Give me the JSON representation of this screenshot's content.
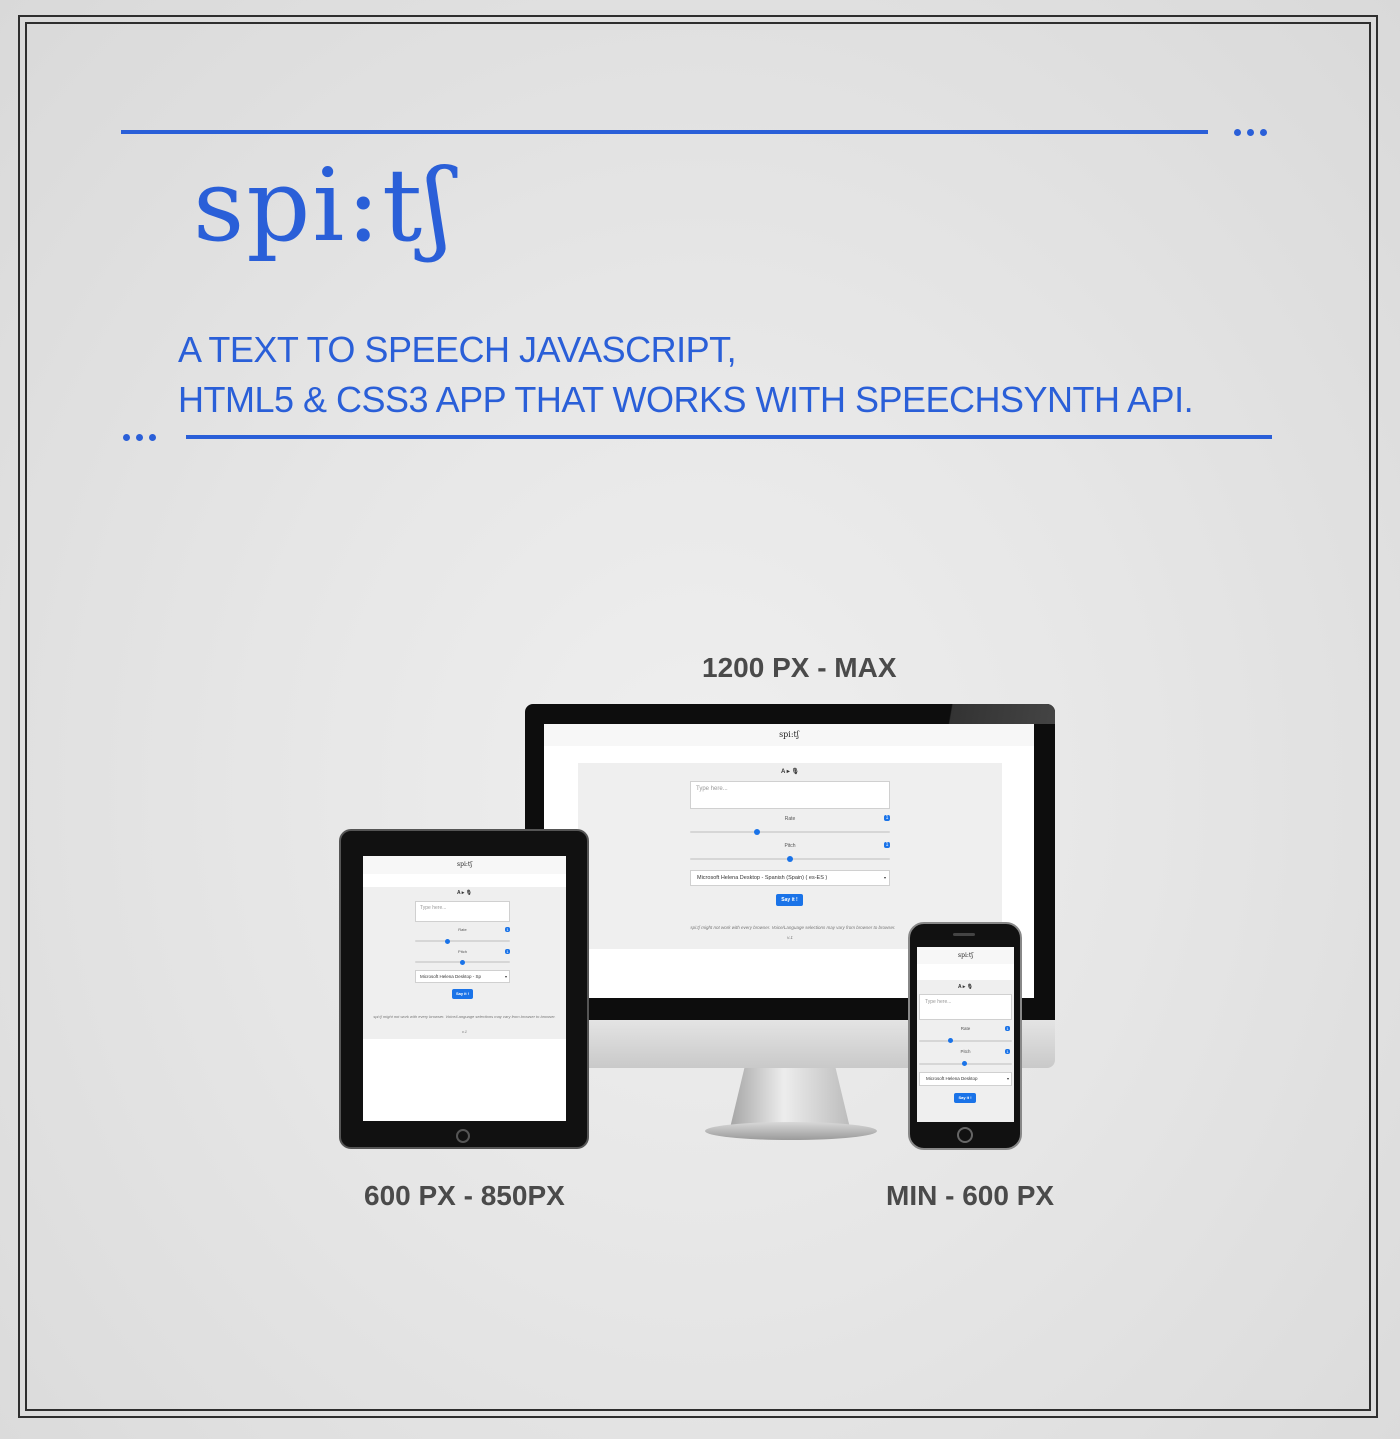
{
  "brand": {
    "logo": "spi:tʃ",
    "accent_color": "#2a5fd8"
  },
  "tagline": {
    "line1": "A TEXT TO SPEECH JAVASCRIPT,",
    "line2": "HTML5 & CSS3 APP THAT WORKS WITH SPEECHSYNTH API."
  },
  "captions": {
    "desktop": "1200 PX - MAX",
    "tablet": "600 PX - 850PX",
    "mobile": "MIN - 600 PX"
  },
  "app": {
    "logo": "spi:tʃ",
    "mode_label": "A ▸ 🎙",
    "text_placeholder": "Type here...",
    "rate_label": "Rate",
    "rate_value": "1",
    "pitch_label": "Pitch",
    "pitch_value": "1",
    "voice_full": "Microsoft Helena Desktop - Spanish (Spain) ( es-ES )",
    "voice_tablet": "Microsoft Helena Desktop - Sp",
    "voice_mobile": "Microsoft Helena Desktop",
    "say_button": "Say it !",
    "note_desktop": "spi:tʃ might not work with every browser. Voice/Language selections may vary from browser to browser.",
    "note_tablet": "spi:tʃ might not work with every browser. Voice/Language selections may vary from browser to browser.",
    "version": "v.1"
  }
}
